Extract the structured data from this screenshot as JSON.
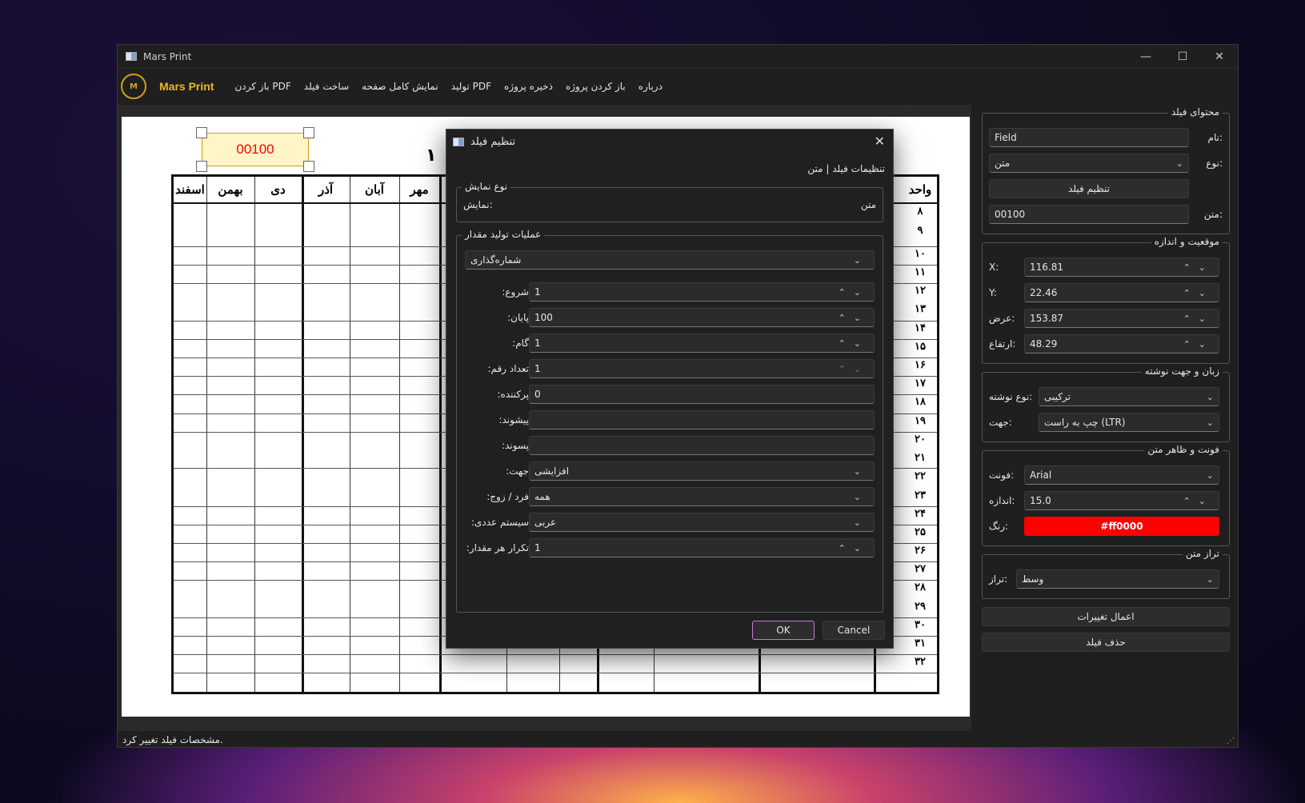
{
  "window": {
    "title": "Mars Print",
    "controls": [
      "—",
      "☐",
      "✕"
    ]
  },
  "menu": {
    "brand": "Mars Print",
    "items": [
      "باز کردن PDF",
      "ساخت فیلد",
      "نمایش کامل صفحه",
      "تولید PDF",
      "ذخیره پروژه",
      "باز کردن پروژه",
      "درباره"
    ]
  },
  "paper": {
    "field_value": "00100",
    "title_fragment": "۱",
    "headers": [
      "اسفند",
      "بهمن",
      "دی",
      "آذر",
      "آبان",
      "مهر",
      "واحد"
    ],
    "row_numbers": [
      "۸",
      "۹",
      "۱۰",
      "۱۱",
      "۱۲",
      "۱۳",
      "۱۴",
      "۱۵",
      "۱۶",
      "۱۷",
      "۱۸",
      "۱۹",
      "۲۰",
      "۲۱",
      "۲۲",
      "۲۳",
      "۲۴",
      "۲۵",
      "۲۶",
      "۲۷",
      "۲۸",
      "۲۹",
      "۳۰",
      "۳۱",
      "۳۲"
    ]
  },
  "status": "مشخصات فیلد تغییر کرد.",
  "panel": {
    "content": {
      "title": "محتوای فیلد",
      "name_label": "نام:",
      "name_value": "Field",
      "type_label": "نوع:",
      "type_value": "متن",
      "config_button": "تنظیم فیلد",
      "text_label": "متن:",
      "text_value": "00100"
    },
    "position": {
      "title": "موقعیت و اندازه",
      "x_label": "X:",
      "x_value": "116.81",
      "y_label": "Y:",
      "y_value": "22.46",
      "w_label": "عرض:",
      "w_value": "153.87",
      "h_label": "ارتفاع:",
      "h_value": "48.29"
    },
    "language": {
      "title": "زبان و جهت نوشته",
      "script_label": "نوع نوشته:",
      "script_value": "ترکیبی",
      "dir_label": "جهت:",
      "dir_value": "چپ به راست (LTR)"
    },
    "font": {
      "title": "فونت و ظاهر متن",
      "font_label": "فونت:",
      "font_value": "Arial",
      "size_label": "اندازه:",
      "size_value": "15.0",
      "color_label": "رنگ:",
      "color_value": "#ff0000"
    },
    "align": {
      "title": "تراز متن",
      "align_label": "تراز:",
      "align_value": "وسط"
    },
    "apply_button": "اعمال تغییرات",
    "delete_button": "حذف فیلد"
  },
  "dialog": {
    "title": "تنظیم فیلد",
    "subtitle": "تنظیمات فیلد | متن",
    "display_group": "نوع نمایش",
    "display_label": "نمایش:",
    "display_value": "متن",
    "gen_group": "عملیات تولید مقدار",
    "mode_value": "شماره‌گذاری",
    "fields": [
      {
        "label": "شروع:",
        "value": "1",
        "kind": "spin"
      },
      {
        "label": "پایان:",
        "value": "100",
        "kind": "spin"
      },
      {
        "label": "گام:",
        "value": "1",
        "kind": "spin"
      },
      {
        "label": "تعداد رقم:",
        "value": "1",
        "kind": "spin-dim"
      },
      {
        "label": "پرکننده:",
        "value": "0",
        "kind": "text"
      },
      {
        "label": "پیشوند:",
        "value": "",
        "kind": "text"
      },
      {
        "label": "پسوند:",
        "value": "",
        "kind": "text"
      },
      {
        "label": "جهت:",
        "value": "افزایشی",
        "kind": "combo"
      },
      {
        "label": "فرد / زوج:",
        "value": "همه",
        "kind": "combo"
      },
      {
        "label": "سیستم عددی:",
        "value": "عربی",
        "kind": "combo"
      },
      {
        "label": "تکرار هر مقدار:",
        "value": "1",
        "kind": "spin"
      }
    ],
    "ok_label": "OK",
    "cancel_label": "Cancel"
  }
}
